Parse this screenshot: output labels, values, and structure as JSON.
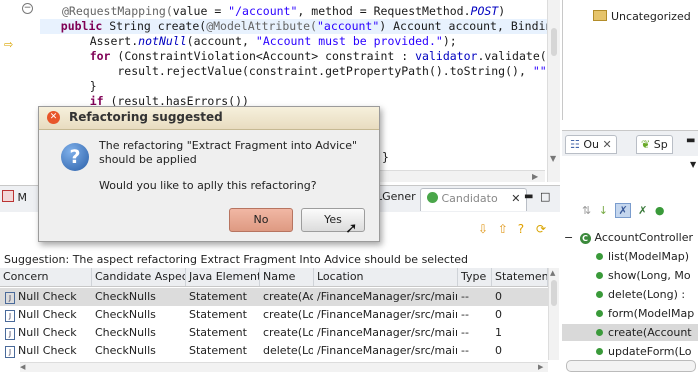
{
  "editor": {
    "lines": [
      "@RequestMapping(value = \"/account\", method = RequestMethod.POST)",
      "public String create(@ModelAttribute(\"account\") Account account, BindingRes",
      "    Assert.notNull(account, \"Account must be provided.\");",
      "    for (ConstraintViolation<Account> constraint : validator.validate(accou",
      "        result.rejectValue(constraint.getPropertyPath().toString(), \"\", con",
      "    }",
      "    if (result.hasErrors())"
    ],
    "tail_brace": "}"
  },
  "uncategorized": {
    "label": "Uncategorized"
  },
  "outline": {
    "tabs": [
      "Ou",
      "Sp"
    ],
    "root": "AccountController",
    "items": [
      "list(ModelMap)",
      "show(Long, Mo",
      "delete(Long) :",
      "form(ModelMap",
      "create(Account",
      "updateForm(Lo"
    ],
    "selected_index": 4
  },
  "bottom": {
    "tabs": {
      "first": "M",
      "middle": "LGener",
      "candidate": "Candidato"
    },
    "suggestion": "Suggestion: The aspect refactoring Extract Fragment Into Advice should be selected",
    "columns": [
      "Concern",
      "Candidate Aspec",
      "Java Element",
      "Name",
      "Location",
      "Type",
      "Statement"
    ],
    "rows": [
      [
        "Null Check",
        "CheckNulls",
        "Statement",
        "create(Ac",
        "/FinanceManager/src/main/j",
        "--",
        "0"
      ],
      [
        "Null Check",
        "CheckNulls",
        "Statement",
        "create(Lo",
        "/FinanceManager/src/main/j",
        "--",
        "0"
      ],
      [
        "Null Check",
        "CheckNulls",
        "Statement",
        "create(Lo",
        "/FinanceManager/src/main/j",
        "--",
        "1"
      ],
      [
        "Null Check",
        "CheckNulls",
        "Statement",
        "delete(Lo",
        "/FinanceManager/src/main/j",
        "--",
        "0"
      ]
    ]
  },
  "dialog": {
    "title": "Refactoring suggested",
    "message": "The refactoring \"Extract Fragment into Advice\" should be applied",
    "question": "Would you like to aplly this refactoring?",
    "no_label": "No",
    "yes_label": "Yes"
  },
  "colors": {
    "highlight_line": "#e8f2fe",
    "keyword": "#7f0055",
    "string": "#2a00ff",
    "dialog_title": "#e8dcc0",
    "no_button": "#e4a590"
  }
}
